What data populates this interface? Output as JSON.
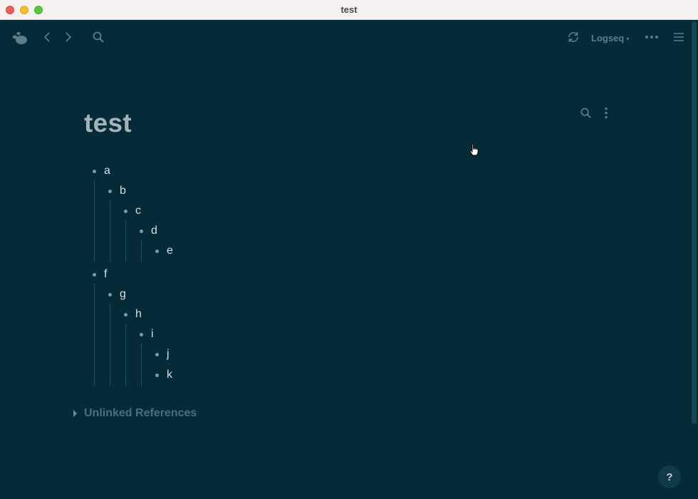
{
  "window": {
    "title": "test"
  },
  "header": {
    "logo_icon": "logseq-logo-icon",
    "back_icon": "chevron-left-icon",
    "forward_icon": "chevron-right-icon",
    "search_icon": "search-icon",
    "sync_icon": "refresh-icon",
    "repo_label": "Logseq",
    "more_icon": "more-horizontal-icon",
    "sidebar_icon": "menu-icon"
  },
  "page": {
    "title": "test",
    "tools": {
      "search_icon": "search-icon",
      "menu_icon": "more-vertical-icon"
    },
    "blocks": [
      {
        "text": "a",
        "level": 0
      },
      {
        "text": "b",
        "level": 1
      },
      {
        "text": "c",
        "level": 2
      },
      {
        "text": "d",
        "level": 3
      },
      {
        "text": "e",
        "level": 4
      },
      {
        "text": "f",
        "level": 0
      },
      {
        "text": "g",
        "level": 1
      },
      {
        "text": "h",
        "level": 2
      },
      {
        "text": "i",
        "level": 3
      },
      {
        "text": "j",
        "level": 4
      },
      {
        "text": "k",
        "level": 4
      }
    ],
    "unlinked_references_label": "Unlinked References"
  },
  "help_label": "?",
  "colors": {
    "background": "#052b39",
    "title": "#a3b3b7",
    "block_text": "#d6dfe1",
    "bullet": "#7a9aa4",
    "header_icon": "#5d7d88"
  }
}
